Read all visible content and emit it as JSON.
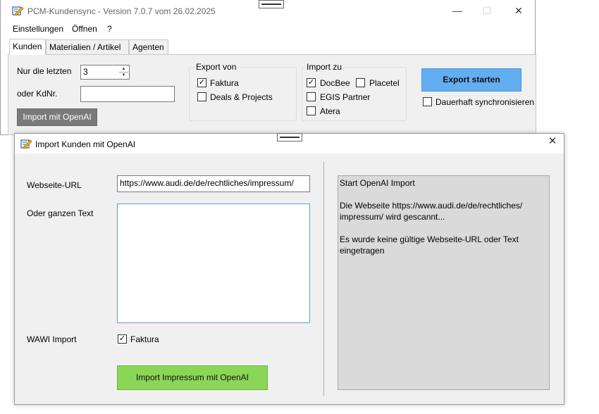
{
  "main_window": {
    "title": "PCM-Kundensync - Version 7.0.7 vom 26.02.2025",
    "controls": {
      "minimize": "—",
      "maximize": "☐",
      "close": "✕"
    },
    "menu": [
      "Einstellungen",
      "Öffnen",
      "?"
    ],
    "tabs": [
      "Kunden",
      "Materialien / Artikel",
      "Agenten"
    ],
    "active_tab": "Kunden",
    "nur_die_letzten_label": "Nur die letzten",
    "nur_die_letzten_value": "3",
    "kdnr_label": "oder KdNr.",
    "kdnr_value": "",
    "import_openai_button": "Import mit OpenAI",
    "export_von": {
      "title": "Export von",
      "faktura": {
        "label": "Faktura",
        "checked": true
      },
      "deals": {
        "label": "Deals & Projects",
        "checked": false
      }
    },
    "import_zu": {
      "title": "Import zu",
      "docbee": {
        "label": "DocBee",
        "checked": true
      },
      "placetel": {
        "label": "Placetel",
        "checked": false
      },
      "egis": {
        "label": "EGIS Partner",
        "checked": false
      },
      "atera": {
        "label": "Atera",
        "checked": false
      }
    },
    "export_button": "Export starten",
    "dauerhaft": {
      "label": "Dauerhaft synchronisieren",
      "checked": false
    }
  },
  "dialog": {
    "title": "Import Kunden mit OpenAI",
    "close": "✕",
    "url_label": "Webseite-URL",
    "url_value": "https://www.audi.de/de/rechtliches/impressum/",
    "text_label": "Oder ganzen Text",
    "text_value": "",
    "wawi_label": "WAWI Import",
    "wawi_faktura": {
      "label": "Faktura",
      "checked": true
    },
    "import_button": "Import Impressum mit OpenAI",
    "log_lines": [
      "Start OpenAI Import",
      "",
      "Die Webseite https://www.audi.de/de/rechtliches/",
      "impressum/ wird gescannt...",
      "",
      "Es wurde keine gültige Webseite-URL oder Text",
      "eingetragen"
    ]
  },
  "colors": {
    "export_button_bg": "#62aef0",
    "import_button_bg": "#8bd656",
    "openai_button_bg": "#7a7a7a",
    "panel_bg": "#f0f0f0",
    "log_bg": "#dadada"
  }
}
